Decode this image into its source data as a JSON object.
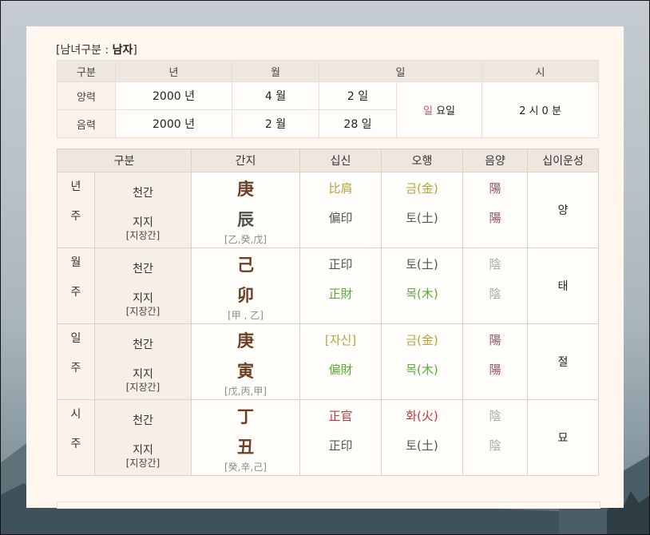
{
  "gender": {
    "prefix": "[남녀구분 : ",
    "value": "남자",
    "suffix": "]"
  },
  "birth_table": {
    "headers": [
      "구분",
      "년",
      "월",
      "일",
      "시"
    ],
    "solar": {
      "label": "양력",
      "year": "2000 년",
      "month": "4 월",
      "day": "2 일"
    },
    "lunar": {
      "label": "음력",
      "year": "2000 년",
      "month": "2 월",
      "day": "28 일"
    },
    "weekday_char": "일",
    "weekday_suffix": " 요일",
    "time": "2 시 0 분"
  },
  "saju_table": {
    "headers": [
      "구분",
      "간지",
      "십신",
      "오행",
      "음양",
      "십이운성"
    ],
    "pillars": [
      {
        "p1": "년",
        "p2": "주",
        "stem_label": "천간",
        "branch_label": "지지",
        "hidden_label": "[지장간]",
        "stem": "庚",
        "branch": "辰",
        "hidden": "[乙,癸,戊]",
        "stem_ten": "比肩",
        "branch_ten": "偏印",
        "stem_elem": "금(金)",
        "branch_elem": "토(土)",
        "stem_yy": "陽",
        "branch_yy": "陽",
        "twelve": "양"
      },
      {
        "p1": "월",
        "p2": "주",
        "stem_label": "천간",
        "branch_label": "지지",
        "hidden_label": "[지장간]",
        "stem": "己",
        "branch": "卯",
        "hidden": "[甲 , 乙]",
        "stem_ten": "正印",
        "branch_ten": "正財",
        "stem_elem": "토(土)",
        "branch_elem": "목(木)",
        "stem_yy": "陰",
        "branch_yy": "陰",
        "twelve": "태"
      },
      {
        "p1": "일",
        "p2": "주",
        "stem_label": "천간",
        "branch_label": "지지",
        "hidden_label": "[지장간]",
        "stem": "庚",
        "branch": "寅",
        "hidden": "[戊,丙,甲]",
        "stem_ten": "[자신]",
        "branch_ten": "偏財",
        "stem_elem": "금(金)",
        "branch_elem": "목(木)",
        "stem_yy": "陽",
        "branch_yy": "陽",
        "twelve": "절"
      },
      {
        "p1": "시",
        "p2": "주",
        "stem_label": "천간",
        "branch_label": "지지",
        "hidden_label": "[지장간]",
        "stem": "丁",
        "branch": "丑",
        "hidden": "[癸,辛,己]",
        "stem_ten": "正官",
        "branch_ten": "正印",
        "stem_elem": "화(火)",
        "branch_elem": "토(土)",
        "stem_yy": "陰",
        "branch_yy": "陰",
        "twelve": "묘"
      }
    ]
  }
}
